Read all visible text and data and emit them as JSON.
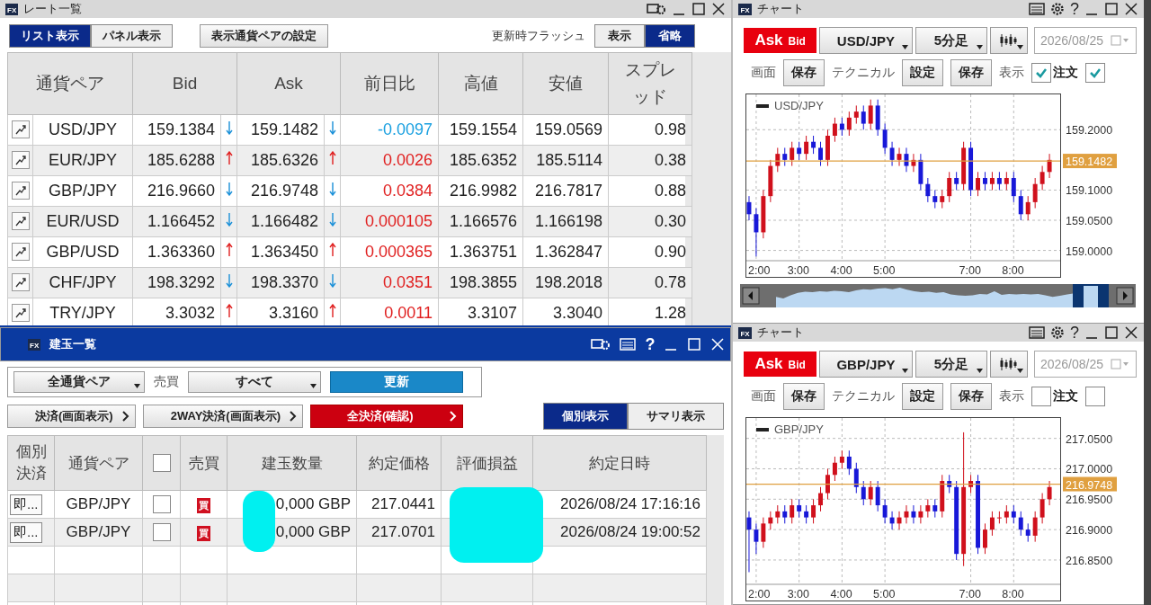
{
  "rate_window": {
    "badge": "FX",
    "title": "レート一覧",
    "active": false,
    "view_tabs": [
      {
        "label": "リスト表示",
        "selected": true
      },
      {
        "label": "パネル表示",
        "selected": false
      }
    ],
    "pair_settings_button": "表示通貨ペアの設定",
    "flash_label": "更新時フラッシュ",
    "flash_options": [
      {
        "label": "表示",
        "selected": false
      },
      {
        "label": "省略",
        "selected": true
      }
    ],
    "columns": [
      "通貨ペア",
      "Bid",
      "Ask",
      "前日比",
      "高値",
      "安値",
      "スプレッド"
    ],
    "rows": [
      {
        "pair": "USD/JPY",
        "bid": "159.1384",
        "bid_up": false,
        "ask": "159.1482",
        "ask_up": false,
        "change": "-0.0097",
        "change_up": false,
        "high": "159.1554",
        "low": "159.0569",
        "spread": "0.98"
      },
      {
        "pair": "EUR/JPY",
        "bid": "185.6288",
        "bid_up": true,
        "ask": "185.6326",
        "ask_up": true,
        "change": "0.0026",
        "change_up": true,
        "high": "185.6352",
        "low": "185.5114",
        "spread": "0.38"
      },
      {
        "pair": "GBP/JPY",
        "bid": "216.9660",
        "bid_up": false,
        "ask": "216.9748",
        "ask_up": false,
        "change": "0.0384",
        "change_up": true,
        "high": "216.9982",
        "low": "216.7817",
        "spread": "0.88"
      },
      {
        "pair": "EUR/USD",
        "bid": "1.166452",
        "bid_up": false,
        "ask": "1.166482",
        "ask_up": false,
        "change": "0.000105",
        "change_up": true,
        "high": "1.166576",
        "low": "1.166198",
        "spread": "0.30"
      },
      {
        "pair": "GBP/USD",
        "bid": "1.363360",
        "bid_up": true,
        "ask": "1.363450",
        "ask_up": true,
        "change": "0.000365",
        "change_up": true,
        "high": "1.363751",
        "low": "1.362847",
        "spread": "0.90"
      },
      {
        "pair": "CHF/JPY",
        "bid": "198.3292",
        "bid_up": false,
        "ask": "198.3370",
        "ask_up": false,
        "change": "0.0351",
        "change_up": true,
        "high": "198.3855",
        "low": "198.2018",
        "spread": "0.78"
      },
      {
        "pair": "TRY/JPY",
        "bid": "3.3032",
        "bid_up": true,
        "ask": "3.3160",
        "ask_up": true,
        "change": "0.0011",
        "change_up": true,
        "high": "3.3107",
        "low": "3.3040",
        "spread": "1.28"
      }
    ]
  },
  "position_window": {
    "badge": "FX",
    "title": "建玉一覧",
    "help": "?",
    "active": true,
    "pair_filter": "全通貨ペア",
    "side_label": "売買",
    "side_filter": "すべて",
    "refresh_button": "更新",
    "actions": [
      {
        "label": "決済(画面表示)",
        "kind": "normal"
      },
      {
        "label": "2WAY決済(画面表示)",
        "kind": "normal"
      },
      {
        "label": "全決済(確認)",
        "kind": "danger"
      }
    ],
    "view_tabs": [
      {
        "label": "個別表示",
        "selected": true
      },
      {
        "label": "サマリ表示",
        "selected": false
      }
    ],
    "columns": [
      {
        "kind": "text",
        "label": "個別決済"
      },
      {
        "kind": "text",
        "label": "通貨ペア"
      },
      {
        "kind": "checkbox",
        "checked": false
      },
      {
        "kind": "text",
        "label": "売買"
      },
      {
        "kind": "text",
        "label": "建玉数量"
      },
      {
        "kind": "text",
        "label": "約定価格"
      },
      {
        "kind": "text",
        "label": "評価損益"
      },
      {
        "kind": "text",
        "label": "約定日時"
      }
    ],
    "rows": [
      {
        "settle_button": "即...",
        "pair": "GBP/JPY",
        "checked": false,
        "side": "買",
        "quantity": "0,000 GBP",
        "price": "217.0441",
        "datetime": "2026/08/24 17:16:16"
      },
      {
        "settle_button": "即...",
        "pair": "GBP/JPY",
        "checked": false,
        "side": "買",
        "quantity": "0,000 GBP",
        "price": "217.0701",
        "datetime": "2026/08/24 19:00:52"
      }
    ],
    "redacted": true
  },
  "charts": [
    {
      "badge": "FX",
      "title": "チャート",
      "help": "?",
      "price_toggle": [
        {
          "label": "Ask",
          "selected": true
        },
        {
          "label": "Bid",
          "selected": false
        }
      ],
      "pair": "USD/JPY",
      "timeframe": "5分足",
      "date": "2026/08/25",
      "date_disabled": true,
      "screen_label": "画面",
      "screen_save": "保存",
      "technical_label": "テクニカル",
      "technical_settings": "設定",
      "technical_save": "保存",
      "display_label": "表示",
      "display_options": [
        {
          "label": "注文",
          "checked": true
        },
        {
          "checked": true
        }
      ],
      "navigator": true,
      "chart_data": {
        "type": "candlestick",
        "title": "USD/JPY",
        "grid": true,
        "xlim": [
          105,
          545
        ],
        "ylim": [
          158.983,
          159.26
        ],
        "yticks": [
          {
            "value": 159.2,
            "label": "159.2000"
          },
          {
            "value": 159.1,
            "label": "159.1000"
          },
          {
            "value": 159.05,
            "label": "159.0500"
          },
          {
            "value": 159,
            "label": "159.0000"
          }
        ],
        "xticks": [
          {
            "value": 120,
            "label": "2:00"
          },
          {
            "value": 180,
            "label": "3:00"
          },
          {
            "value": 240,
            "label": "4:00"
          },
          {
            "value": 300,
            "label": "5:00"
          },
          {
            "value": 420,
            "label": "7:00"
          },
          {
            "value": 480,
            "label": "8:00"
          }
        ],
        "ref_lines": [
          {
            "axis": "y",
            "value": 159.1482,
            "label": "159.1482",
            "color": "#e0a040"
          }
        ],
        "x": [
          110,
          120,
          130,
          140,
          150,
          160,
          170,
          180,
          190,
          200,
          210,
          220,
          230,
          240,
          250,
          260,
          270,
          280,
          290,
          300,
          310,
          320,
          330,
          340,
          350,
          360,
          370,
          380,
          390,
          400,
          410,
          420,
          430,
          440,
          450,
          460,
          470,
          480,
          490,
          500,
          510,
          520,
          530
        ],
        "ohlc": [
          [
            159.08,
            159.09,
            159.05,
            159.06
          ],
          [
            159.06,
            159.07,
            158.99,
            159.03
          ],
          [
            159.03,
            159.1,
            159.02,
            159.09
          ],
          [
            159.09,
            159.15,
            159.08,
            159.14
          ],
          [
            159.14,
            159.17,
            159.13,
            159.16
          ],
          [
            159.16,
            159.17,
            159.14,
            159.15
          ],
          [
            159.15,
            159.18,
            159.14,
            159.17
          ],
          [
            159.17,
            159.18,
            159.15,
            159.16
          ],
          [
            159.16,
            159.19,
            159.15,
            159.18
          ],
          [
            159.18,
            159.19,
            159.16,
            159.17
          ],
          [
            159.17,
            159.18,
            159.14,
            159.15
          ],
          [
            159.15,
            159.2,
            159.14,
            159.19
          ],
          [
            159.19,
            159.22,
            159.18,
            159.21
          ],
          [
            159.21,
            159.22,
            159.19,
            159.2
          ],
          [
            159.2,
            159.23,
            159.19,
            159.22
          ],
          [
            159.22,
            159.24,
            159.21,
            159.23
          ],
          [
            159.23,
            159.24,
            159.2,
            159.21
          ],
          [
            159.21,
            159.25,
            159.2,
            159.24
          ],
          [
            159.24,
            159.25,
            159.19,
            159.2
          ],
          [
            159.2,
            159.21,
            159.16,
            159.17
          ],
          [
            159.17,
            159.18,
            159.14,
            159.15
          ],
          [
            159.15,
            159.17,
            159.14,
            159.16
          ],
          [
            159.16,
            159.17,
            159.13,
            159.14
          ],
          [
            159.14,
            159.16,
            159.13,
            159.15
          ],
          [
            159.15,
            159.16,
            159.1,
            159.11
          ],
          [
            159.11,
            159.12,
            159.08,
            159.09
          ],
          [
            159.09,
            159.1,
            159.07,
            159.08
          ],
          [
            159.08,
            159.1,
            159.07,
            159.09
          ],
          [
            159.09,
            159.13,
            159.08,
            159.12
          ],
          [
            159.12,
            159.13,
            159.1,
            159.11
          ],
          [
            159.11,
            159.18,
            159.1,
            159.17
          ],
          [
            159.17,
            159.18,
            159.09,
            159.1
          ],
          [
            159.1,
            159.13,
            159.09,
            159.12
          ],
          [
            159.12,
            159.13,
            159.1,
            159.11
          ],
          [
            159.11,
            159.13,
            159.1,
            159.12
          ],
          [
            159.12,
            159.13,
            159.1,
            159.11
          ],
          [
            159.11,
            159.13,
            159.1,
            159.12
          ],
          [
            159.12,
            159.13,
            159.08,
            159.09
          ],
          [
            159.09,
            159.1,
            159.05,
            159.06
          ],
          [
            159.06,
            159.09,
            159.05,
            159.08
          ],
          [
            159.08,
            159.12,
            159.07,
            159.11
          ],
          [
            159.11,
            159.14,
            159.1,
            159.13
          ],
          [
            159.13,
            159.16,
            159.12,
            159.15
          ]
        ]
      }
    },
    {
      "badge": "FX",
      "title": "チャート",
      "help": "?",
      "price_toggle": [
        {
          "label": "Ask",
          "selected": true
        },
        {
          "label": "Bid",
          "selected": false
        }
      ],
      "pair": "GBP/JPY",
      "timeframe": "5分足",
      "date": "2026/08/25",
      "date_disabled": true,
      "screen_label": "画面",
      "screen_save": "保存",
      "technical_label": "テクニカル",
      "technical_settings": "設定",
      "technical_save": "保存",
      "display_label": "表示",
      "display_options": [
        {
          "label": "注文",
          "checked": false
        },
        {
          "checked": false
        }
      ],
      "navigator": false,
      "chart_data": {
        "type": "candlestick",
        "title": "GBP/JPY",
        "grid": true,
        "xlim": [
          105,
          545
        ],
        "ylim": [
          216.81,
          217.085
        ],
        "yticks": [
          {
            "value": 217.05,
            "label": "217.0500"
          },
          {
            "value": 217,
            "label": "217.0000"
          },
          {
            "value": 216.95,
            "label": "216.9500"
          },
          {
            "value": 216.9,
            "label": "216.9000"
          },
          {
            "value": 216.85,
            "label": "216.8500"
          }
        ],
        "xticks": [
          {
            "value": 120,
            "label": "2:00"
          },
          {
            "value": 180,
            "label": "3:00"
          },
          {
            "value": 240,
            "label": "4:00"
          },
          {
            "value": 300,
            "label": "5:00"
          },
          {
            "value": 420,
            "label": "7:00"
          },
          {
            "value": 480,
            "label": "8:00"
          }
        ],
        "ref_lines": [
          {
            "axis": "y",
            "value": 216.9748,
            "label": "216.9748",
            "color": "#e0a040"
          }
        ],
        "x": [
          110,
          120,
          130,
          140,
          150,
          160,
          170,
          180,
          190,
          200,
          210,
          220,
          230,
          240,
          250,
          260,
          270,
          280,
          290,
          300,
          310,
          320,
          330,
          340,
          350,
          360,
          370,
          380,
          390,
          400,
          410,
          420,
          430,
          440,
          450,
          460,
          470,
          480,
          490,
          500,
          510,
          520,
          530
        ],
        "ohlc": [
          [
            216.92,
            216.93,
            216.83,
            216.9
          ],
          [
            216.9,
            216.91,
            216.86,
            216.88
          ],
          [
            216.88,
            216.92,
            216.87,
            216.91
          ],
          [
            216.91,
            216.93,
            216.9,
            216.92
          ],
          [
            216.92,
            216.94,
            216.91,
            216.93
          ],
          [
            216.93,
            216.94,
            216.91,
            216.92
          ],
          [
            216.92,
            216.95,
            216.91,
            216.94
          ],
          [
            216.94,
            216.95,
            216.92,
            216.93
          ],
          [
            216.93,
            216.94,
            216.91,
            216.92
          ],
          [
            216.92,
            216.95,
            216.91,
            216.94
          ],
          [
            216.94,
            216.97,
            216.93,
            216.96
          ],
          [
            216.96,
            217,
            216.95,
            216.99
          ],
          [
            216.99,
            217.02,
            216.98,
            217.01
          ],
          [
            217.01,
            217.03,
            217,
            217.02
          ],
          [
            217.02,
            217.03,
            216.99,
            217
          ],
          [
            217,
            217.01,
            216.96,
            216.97
          ],
          [
            216.97,
            216.98,
            216.94,
            216.95
          ],
          [
            216.95,
            216.98,
            216.94,
            216.97
          ],
          [
            216.97,
            216.98,
            216.93,
            216.94
          ],
          [
            216.94,
            216.95,
            216.91,
            216.92
          ],
          [
            216.92,
            216.93,
            216.9,
            216.91
          ],
          [
            216.91,
            216.93,
            216.9,
            216.92
          ],
          [
            216.92,
            216.94,
            216.91,
            216.93
          ],
          [
            216.93,
            216.94,
            216.91,
            216.92
          ],
          [
            216.92,
            216.94,
            216.91,
            216.93
          ],
          [
            216.93,
            216.95,
            216.92,
            216.94
          ],
          [
            216.94,
            216.95,
            216.92,
            216.93
          ],
          [
            216.93,
            216.99,
            216.92,
            216.98
          ],
          [
            216.98,
            216.99,
            216.96,
            216.97
          ],
          [
            216.97,
            216.98,
            216.85,
            216.86
          ],
          [
            216.86,
            217.06,
            216.84,
            216.97
          ],
          [
            216.97,
            216.99,
            216.96,
            216.98
          ],
          [
            216.98,
            216.99,
            216.86,
            216.87
          ],
          [
            216.87,
            216.91,
            216.86,
            216.9
          ],
          [
            216.9,
            216.93,
            216.89,
            216.92
          ],
          [
            216.92,
            216.93,
            216.91,
            216.92
          ],
          [
            216.92,
            216.94,
            216.91,
            216.93
          ],
          [
            216.93,
            216.94,
            216.91,
            216.92
          ],
          [
            216.92,
            216.93,
            216.89,
            216.9
          ],
          [
            216.9,
            216.91,
            216.88,
            216.89
          ],
          [
            216.89,
            216.93,
            216.88,
            216.92
          ],
          [
            216.92,
            216.96,
            216.91,
            216.95
          ],
          [
            216.95,
            216.98,
            216.94,
            216.97
          ]
        ]
      }
    }
  ]
}
